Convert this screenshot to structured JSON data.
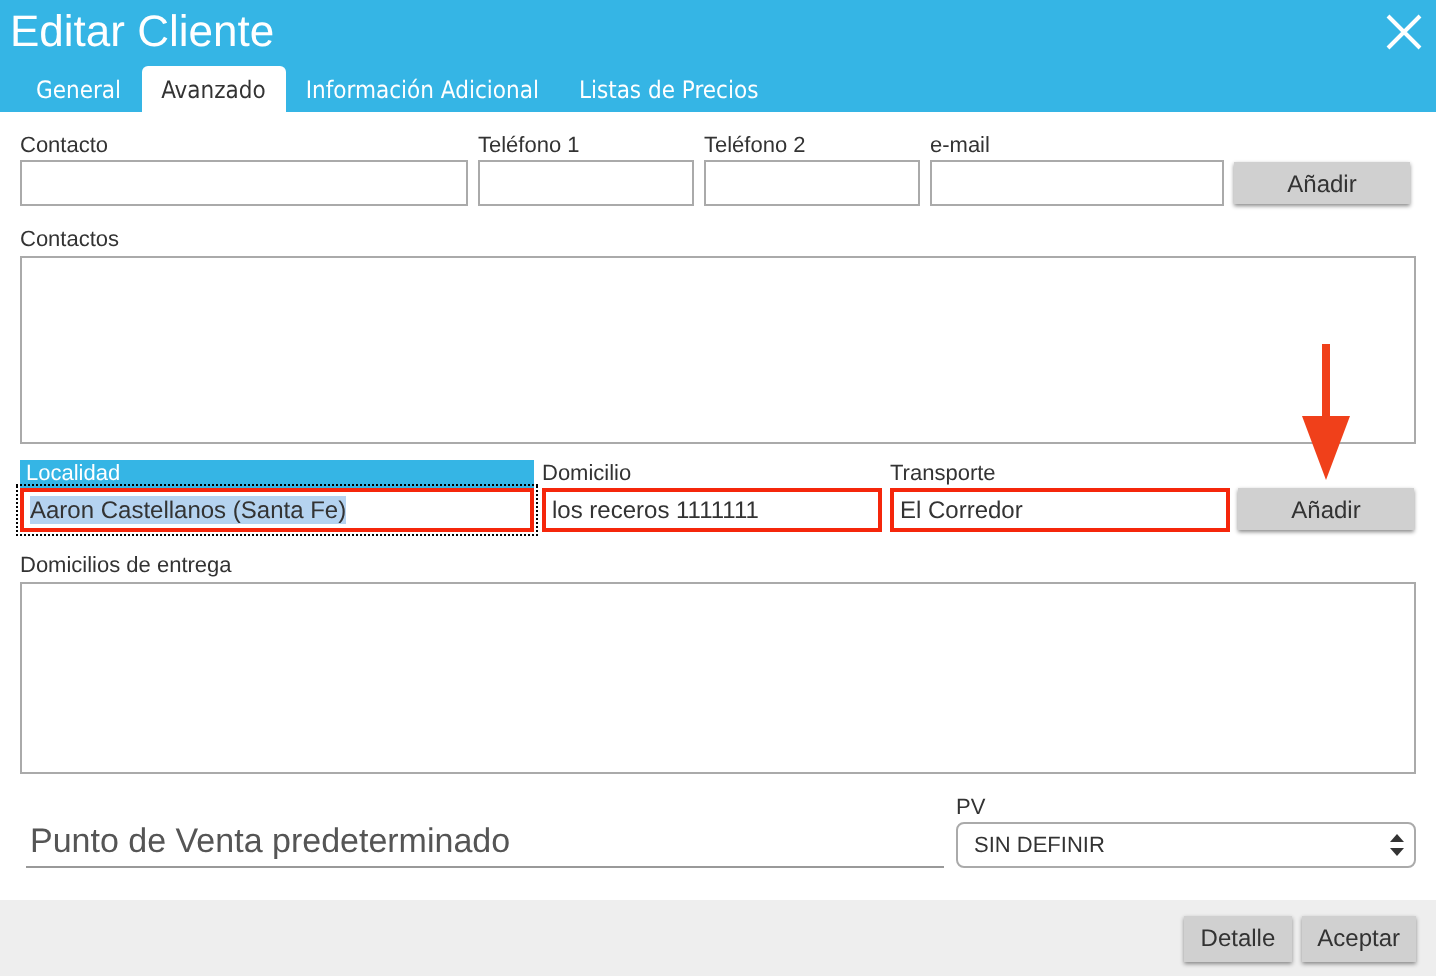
{
  "window": {
    "title": "Editar Cliente"
  },
  "tabs": [
    {
      "label": "General",
      "selected": false
    },
    {
      "label": "Avanzado",
      "selected": true
    },
    {
      "label": "Información Adicional",
      "selected": false
    },
    {
      "label": "Listas de Precios",
      "selected": false
    }
  ],
  "contact_fields": [
    {
      "label": "Contacto"
    },
    {
      "label": "Teléfono 1"
    },
    {
      "label": "Teléfono 2"
    },
    {
      "label": "e-mail"
    }
  ],
  "contact_add_button": "Añadir",
  "contacts_label": "Contactos",
  "address_fields": [
    {
      "label": "Localidad",
      "value": "Aaron Castellanos (Santa Fe)",
      "focused": true,
      "highlighted": true
    },
    {
      "label": "Domicilio",
      "value": "los receros 1111111",
      "focused": false,
      "highlighted": true
    },
    {
      "label": "Transporte",
      "value": "El Corredor",
      "focused": false,
      "highlighted": true
    }
  ],
  "address_add_button": {
    "label": "Añadir",
    "arrow_annotation": true
  },
  "delivery_label": "Domicilios de entrega",
  "default_pos": {
    "placeholder": "Punto de Venta predeterminado"
  },
  "pv": {
    "label": "PV",
    "value": "SIN DEFINIR"
  },
  "footer_buttons": [
    "Detalle",
    "Aceptar"
  ]
}
